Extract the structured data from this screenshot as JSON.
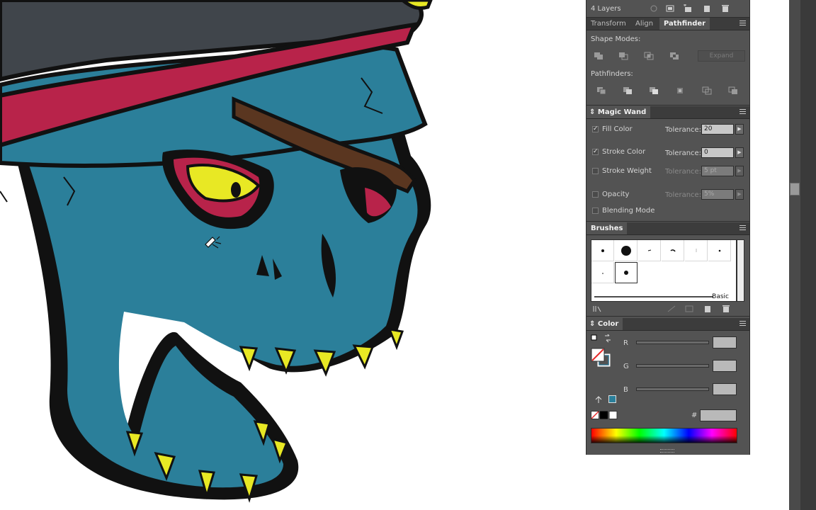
{
  "layers": {
    "count_label": "4 Layers"
  },
  "tabs": [
    {
      "label": "Transform",
      "active": false
    },
    {
      "label": "Align",
      "active": false
    },
    {
      "label": "Pathfinder",
      "active": true
    }
  ],
  "pathfinder": {
    "shape_modes_label": "Shape Modes:",
    "expand_label": "Expand",
    "pathfinders_label": "Pathfinders:"
  },
  "magic_wand": {
    "title": "Magic Wand",
    "rows": [
      {
        "label": "Fill Color",
        "checked": true,
        "tolerance_label": "Tolerance:",
        "value": "20",
        "enabled": true
      },
      {
        "label": "Stroke Color",
        "checked": true,
        "tolerance_label": "Tolerance:",
        "value": "0",
        "enabled": true
      },
      {
        "label": "Stroke Weight",
        "checked": false,
        "tolerance_label": "Tolerance:",
        "value": "5 pt",
        "enabled": false
      },
      {
        "label": "Opacity",
        "checked": false,
        "tolerance_label": "Tolerance:",
        "value": "5%",
        "enabled": false
      },
      {
        "label": "Blending Mode",
        "checked": false
      }
    ]
  },
  "brushes": {
    "title": "Brushes",
    "basic_label": "Basic"
  },
  "color": {
    "title": "Color",
    "channels": [
      "R",
      "G",
      "B"
    ],
    "hex_label": "#"
  },
  "colors": {
    "panel_bg": "#535353",
    "skull_blue": "#2b7f9a",
    "bandana_red": "#b8234a",
    "eye_yellow": "#e8e824",
    "strap_brown": "#5a3620",
    "hat_gray": "#40454b"
  }
}
